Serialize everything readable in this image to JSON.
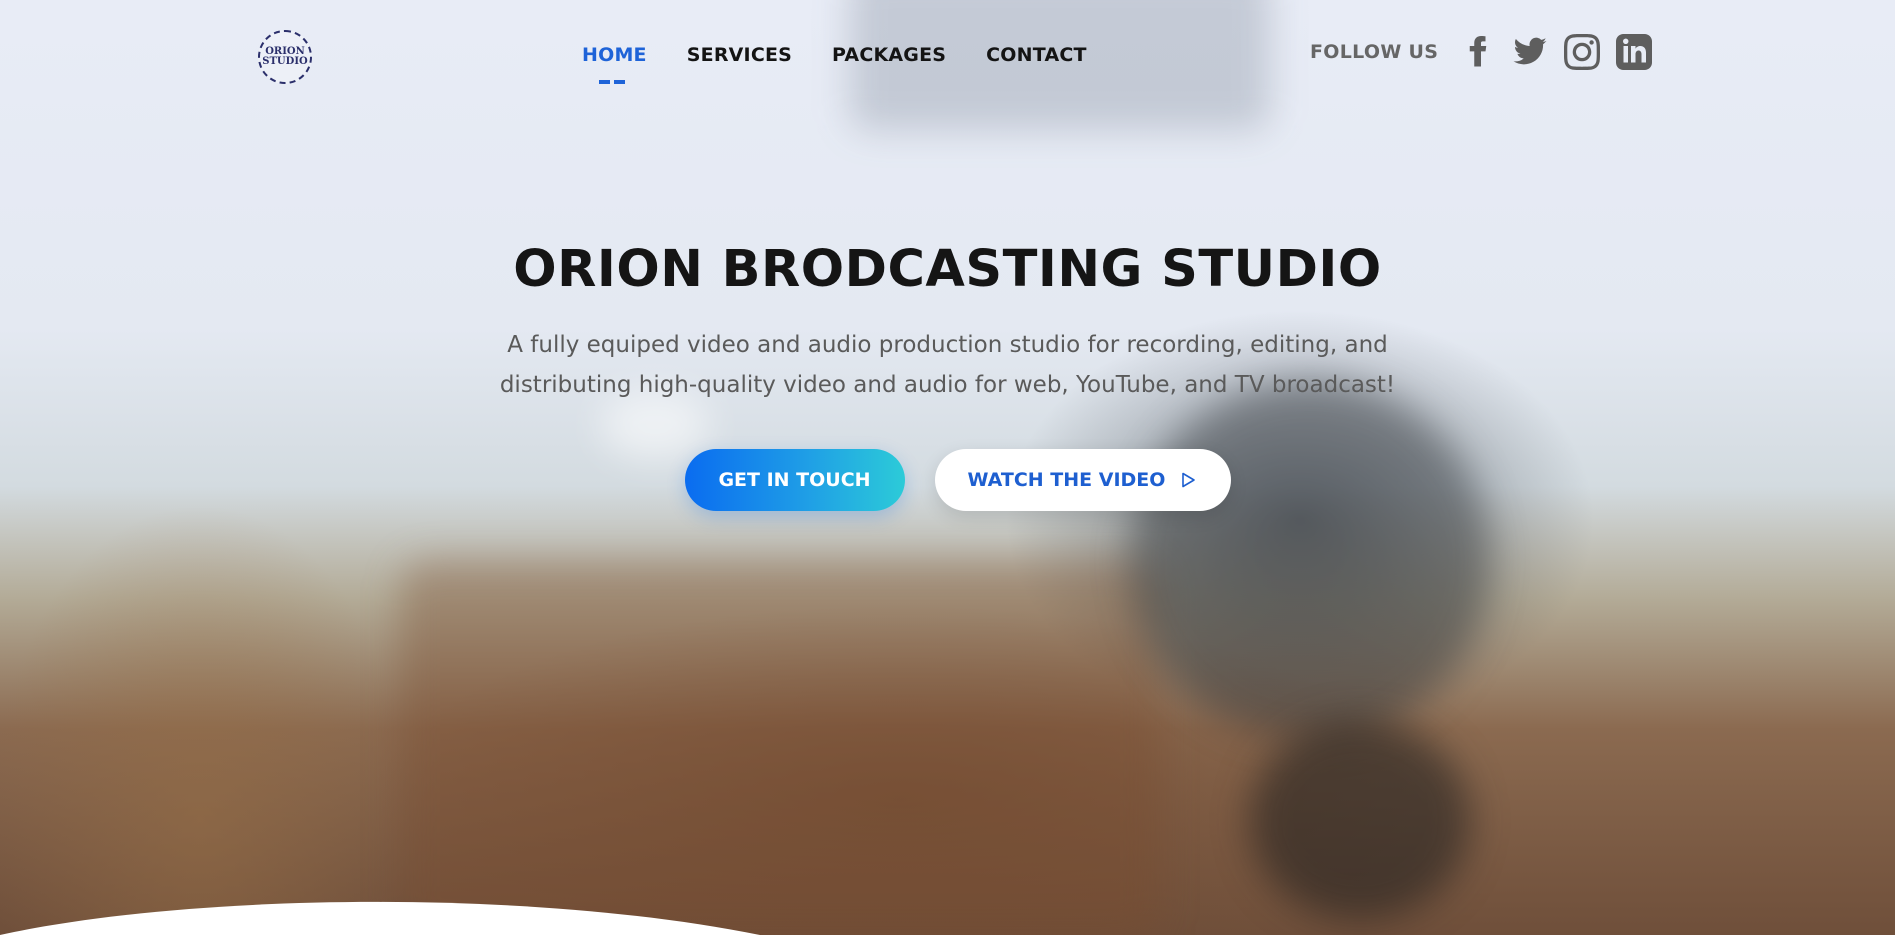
{
  "logo": {
    "line1": "ORION",
    "line2": "STUDIO"
  },
  "nav": {
    "items": [
      {
        "label": "HOME",
        "active": true
      },
      {
        "label": "SERVICES",
        "active": false
      },
      {
        "label": "PACKAGES",
        "active": false
      },
      {
        "label": "CONTACT",
        "active": false
      }
    ]
  },
  "social": {
    "label": "FOLLOW US",
    "icons": [
      "facebook-icon",
      "twitter-icon",
      "instagram-icon",
      "linkedin-icon"
    ]
  },
  "hero": {
    "title": "ORION BRODCASTING STUDIO",
    "subtitle": "A fully equiped video and audio production studio for recording, editing, and distributing high-quality video and audio for web, YouTube, and TV broadcast!",
    "primary_button": "GET IN TOUCH",
    "secondary_button": "WATCH THE VIDEO"
  },
  "colors": {
    "accent": "#1e63d8",
    "gradient_start": "#0a6cf0",
    "gradient_end": "#2ccbd8",
    "text_dark": "#151515",
    "text_muted": "#5a5a5a"
  }
}
